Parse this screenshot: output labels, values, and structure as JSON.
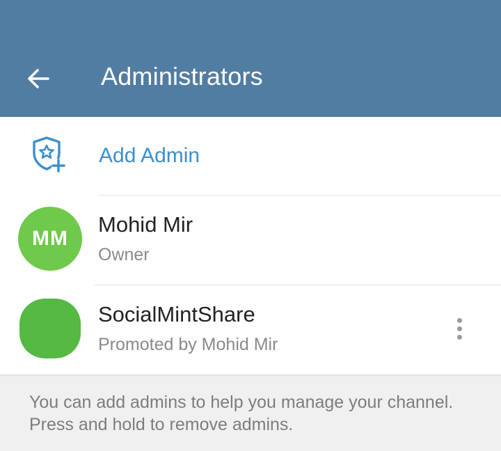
{
  "header": {
    "title": "Administrators",
    "back_icon": "arrow-left-icon",
    "background_color": "#527da3"
  },
  "add_admin": {
    "label": "Add Admin",
    "icon": "shield-star-plus-icon",
    "accent_color": "#3a8fcf"
  },
  "admins": [
    {
      "initials": "MM",
      "name": "Mohid Mir",
      "role": "Owner",
      "avatar_color": "#6fc94a"
    },
    {
      "initials": "",
      "name": "SocialMintShare",
      "role": "Promoted by Mohid Mir",
      "avatar_color": "#55b944",
      "menu_icon": "more-vertical-icon"
    }
  ],
  "footer": {
    "info_text": "You can add admins to help you manage your channel. Press and hold to remove admins."
  }
}
